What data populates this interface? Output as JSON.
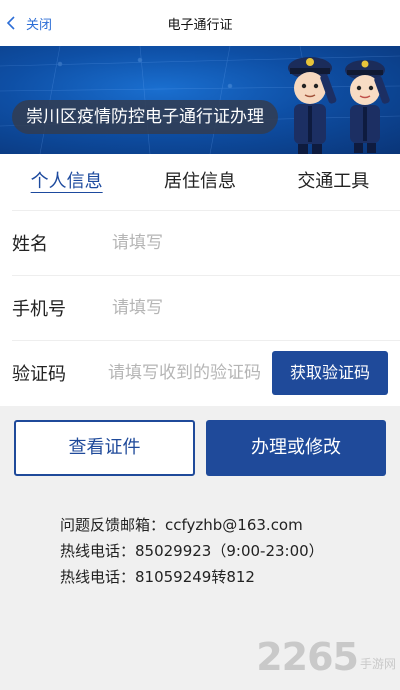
{
  "header": {
    "back_label": "关闭",
    "title": "电子通行证"
  },
  "banner": {
    "title": "崇川区疫情防控电子通行证办理"
  },
  "tabs": [
    {
      "label": "个人信息",
      "active": true
    },
    {
      "label": "居住信息",
      "active": false
    },
    {
      "label": "交通工具",
      "active": false
    }
  ],
  "form": {
    "name_label": "姓名",
    "name_placeholder": "请填写",
    "phone_label": "手机号",
    "phone_placeholder": "请填写",
    "code_label": "验证码",
    "code_placeholder": "请填写收到的验证码",
    "get_code_button": "获取验证码"
  },
  "actions": {
    "view_button": "查看证件",
    "apply_button": "办理或修改"
  },
  "info": {
    "email": "问题反馈邮箱：ccfyzhb@163.com",
    "hotline1": "热线电话：85029923（9:00-23:00）",
    "hotline2": "热线电话：81059249转812"
  },
  "watermark": {
    "main": "2265",
    "sub": "手游网"
  },
  "colors": {
    "primary": "#1f4a9a",
    "link": "#2d6ed6",
    "banner": "#0e4fa5"
  }
}
